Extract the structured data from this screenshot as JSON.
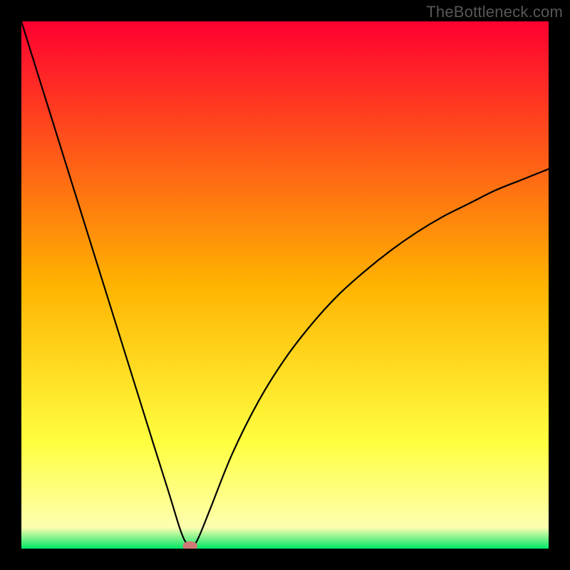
{
  "watermark": "TheBottleneck.com",
  "chart_data": {
    "type": "line",
    "title": "",
    "xlabel": "",
    "ylabel": "",
    "xlim": [
      0,
      100
    ],
    "ylim": [
      0,
      100
    ],
    "grid": false,
    "legend": false,
    "background_gradient": {
      "stops": [
        {
          "y": 100,
          "color": "#ff0030"
        },
        {
          "y": 50,
          "color": "#ffb300"
        },
        {
          "y": 20,
          "color": "#ffff40"
        },
        {
          "y": 4,
          "color": "#fdffb0"
        },
        {
          "y": 0,
          "color": "#00e766"
        }
      ]
    },
    "series": [
      {
        "name": "bottleneck-curve",
        "x": [
          0,
          5,
          10,
          15,
          20,
          25,
          28,
          30,
          31,
          32,
          33,
          34,
          36,
          40,
          45,
          50,
          55,
          60,
          65,
          70,
          75,
          80,
          85,
          90,
          95,
          100
        ],
        "values": [
          100,
          84,
          68,
          52,
          36,
          20,
          10.5,
          4,
          1.5,
          0.5,
          1,
          3,
          8,
          18,
          28,
          36,
          42.5,
          48,
          52.5,
          56.5,
          60,
          63,
          65.5,
          68,
          70,
          72
        ]
      }
    ],
    "marker": {
      "name": "optimal-point",
      "x": 32,
      "y": 0.5,
      "color": "#cf7a75",
      "rx": 1.4,
      "ry": 0.9
    }
  }
}
